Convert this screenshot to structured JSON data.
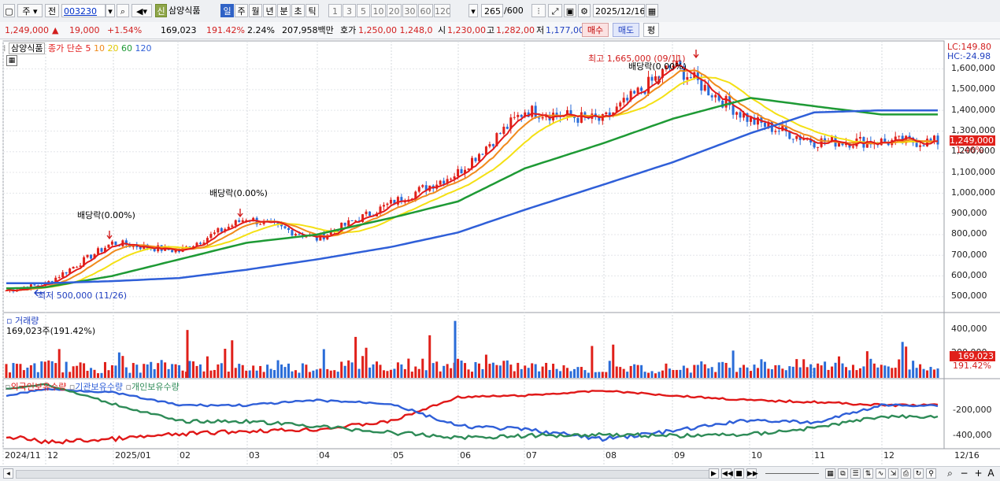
{
  "toolbar": {
    "market_label": "주",
    "prev_label": "전",
    "stock_code": "003230",
    "new_badge": "신",
    "stock_name": "삼양식품",
    "periods": [
      "일",
      "주",
      "월",
      "년",
      "분",
      "초",
      "틱"
    ],
    "active_period": "일",
    "intervals": [
      "1",
      "3",
      "5",
      "10",
      "20",
      "30",
      "60",
      "120"
    ],
    "range_value": "265",
    "range_total": "/600",
    "date_value": "2025/12/16"
  },
  "quote": {
    "price": "1,249,000",
    "change": "19,000",
    "change_pct": "+1.54%",
    "volume": "169,023",
    "volume_pct": "191.42%",
    "turnover_pct": "2.24%",
    "amount": "207,958백만",
    "hoga_label": "호가",
    "hoga_values": "1,250,00 1,248,0",
    "open_label": "시",
    "open_value": "1,230,00",
    "high_label": "고",
    "high_value": "1,282,00",
    "low_label": "저",
    "low_value": "1,177,00",
    "buy_label": "매수",
    "sell_label": "매도",
    "flat_label": "평"
  },
  "legend": {
    "name": "삼양식품",
    "title": "종가 단순 5",
    "ma10": "10",
    "ma20": "20",
    "ma60": "60",
    "ma120": "120"
  },
  "annotations": {
    "high": "최고 1,665,000 (09/11)",
    "low": "최저 500,000 (11/26)",
    "dividend1": "배당락(0.00%)",
    "dividend2": "배당락(0.00%)",
    "dividend3": "배당락(0.00%)"
  },
  "right_axis": {
    "lc": "LC:149.80",
    "hc": "HC:-24.98",
    "price_ticks": [
      "1,600,000",
      "1,500,000",
      "1,400,000",
      "1,300,000",
      "1,200,000",
      "1,100,000",
      "1,000,000",
      "900,000",
      "800,000",
      "700,000",
      "600,000",
      "500,000"
    ],
    "current_price": "1,249,000",
    "current_pct": "1.46%",
    "volume_ticks": [
      "400,000",
      "200,000"
    ],
    "current_volume": "169,023",
    "current_volume_pct": "191.42%",
    "holding_ticks": [
      "-200,000",
      "-400,000"
    ],
    "last_date": "12/16"
  },
  "volume_panel": {
    "title": "거래량",
    "summary": "169,023주(191.42%)"
  },
  "holding_panel": {
    "foreign": "외국인보유수량",
    "institution": "기관보유수량",
    "individual": "개인보유수량"
  },
  "x_axis": [
    "2024/11",
    "12",
    "2025/01",
    "02",
    "03",
    "04",
    "05",
    "06",
    "07",
    "08",
    "09",
    "10",
    "11",
    "12"
  ],
  "colors": {
    "candle_up": "#e0201a",
    "candle_down": "#2a6cd8",
    "ma5": "#e21b1b",
    "ma10": "#f08a1c",
    "ma20": "#f4e014",
    "ma60": "#1e9a35",
    "ma120": "#2f5fd8",
    "foreign": "#e01818",
    "institution": "#2f5fd8",
    "individual": "#2e8b57"
  },
  "chart_data": [
    {
      "type": "line",
      "title": "",
      "x": [
        "2024/11",
        "2024/12",
        "2025/01",
        "2025/02",
        "2025/03",
        "2025/04",
        "2025/05",
        "2025/06",
        "2025/07",
        "2025/08",
        "2025/09",
        "2025/10",
        "2025/11",
        "2025/12"
      ],
      "series": [
        {
          "name": "종가",
          "values": [
            530000,
            560000,
            760000,
            720000,
            880000,
            780000,
            950000,
            1100000,
            1400000,
            1350000,
            1620000,
            1350000,
            1250000,
            1249000
          ]
        },
        {
          "name": "60",
          "values": [
            540000,
            545000,
            600000,
            680000,
            760000,
            800000,
            880000,
            960000,
            1120000,
            1240000,
            1360000,
            1460000,
            1420000,
            1380000
          ]
        },
        {
          "name": "120",
          "values": [
            565000,
            565000,
            575000,
            590000,
            630000,
            680000,
            740000,
            810000,
            920000,
            1040000,
            1150000,
            1290000,
            1390000,
            1400000
          ]
        }
      ],
      "ylim": [
        450000,
        1720000
      ]
    },
    {
      "type": "bar",
      "title": "거래량",
      "x": [
        "2024/11",
        "2024/12",
        "2025/01",
        "2025/02",
        "2025/03",
        "2025/04",
        "2025/05",
        "2025/06",
        "2025/07",
        "2025/08",
        "2025/09",
        "2025/10",
        "2025/11",
        "2025/12"
      ],
      "values": [
        90000,
        110000,
        80000,
        380000,
        90000,
        100000,
        120000,
        440000,
        100000,
        80000,
        90000,
        150000,
        110000,
        169023
      ],
      "ylim": [
        0,
        450000
      ]
    },
    {
      "type": "line",
      "x": [
        "2024/11",
        "2024/12",
        "2025/01",
        "2025/02",
        "2025/03",
        "2025/04",
        "2025/05",
        "2025/06",
        "2025/07",
        "2025/08",
        "2025/09",
        "2025/10",
        "2025/11",
        "2025/12"
      ],
      "series": [
        {
          "name": "외국인보유수량",
          "values": [
            -420000,
            -460000,
            -440000,
            -410000,
            -390000,
            -380000,
            -330000,
            -180000,
            -170000,
            -140000,
            -170000,
            -200000,
            -210000,
            -230000
          ]
        },
        {
          "name": "기관보유수량",
          "values": [
            -170000,
            -130000,
            -150000,
            -230000,
            -230000,
            -200000,
            -220000,
            -360000,
            -380000,
            -440000,
            -390000,
            -320000,
            -340000,
            -230000
          ]
        },
        {
          "name": "개인보유수량",
          "values": [
            -130000,
            -100000,
            -220000,
            -330000,
            -330000,
            -360000,
            -400000,
            -430000,
            -420000,
            -410000,
            -420000,
            -410000,
            -370000,
            -300000
          ]
        }
      ],
      "ylim": [
        -480000,
        -90000
      ]
    }
  ]
}
